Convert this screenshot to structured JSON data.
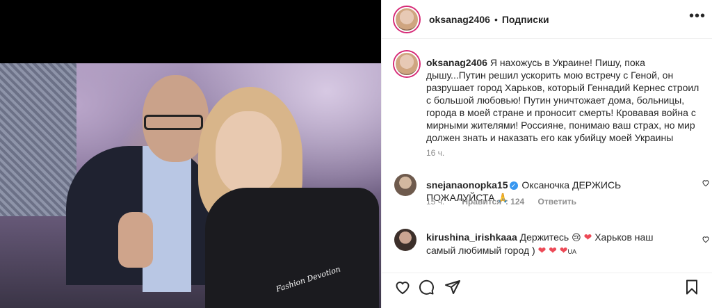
{
  "post": {
    "username": "oksanag2406",
    "follow_label": "Подписки",
    "dot": "•",
    "more": "•••",
    "caption_text": "Я нахожусь в Украине! Пишу, пока дышу...Путин решил ускорить мою встречу с Геной, он разрушает город Харьков, который Геннадий Кернес строил с большой любовью! Путин уничтожает дома, больницы, города в моей стране и проносит смерть! Кровавая война с мирными жителями! Россияне, понимаю ваш страх, но мир должен знать и наказать его как убийцу моей Украины",
    "caption_time": "16 ч.",
    "sleeve_text": "Fashion Devotion"
  },
  "comments": [
    {
      "user": "snejanaonopka15",
      "verified": true,
      "text": "Оксаночка ДЕРЖИСЬ ПОЖАЛУЙСТА",
      "emoji": "🙏",
      "time": "15 ч.",
      "likes_label": "\"Нравится\": 124",
      "reply_label": "Ответить"
    },
    {
      "user": "kirushina_irishkaaa",
      "text_part1": "Держитесь",
      "emoji1": "😢",
      "heart1": "❤",
      "text_part2": "Харьков наш самый любимый город )",
      "hearts": "❤ ❤ ❤",
      "flag": "UA"
    }
  ],
  "icons": {
    "like": "heart-outline-icon",
    "comment": "comment-bubble-icon",
    "share": "paper-plane-icon",
    "save": "bookmark-icon",
    "comment_like": "heart-outline-icon"
  },
  "colors": {
    "text": "#262626",
    "muted": "#8e8e8e",
    "verified": "#3897f0",
    "heart": "#ed4956"
  }
}
